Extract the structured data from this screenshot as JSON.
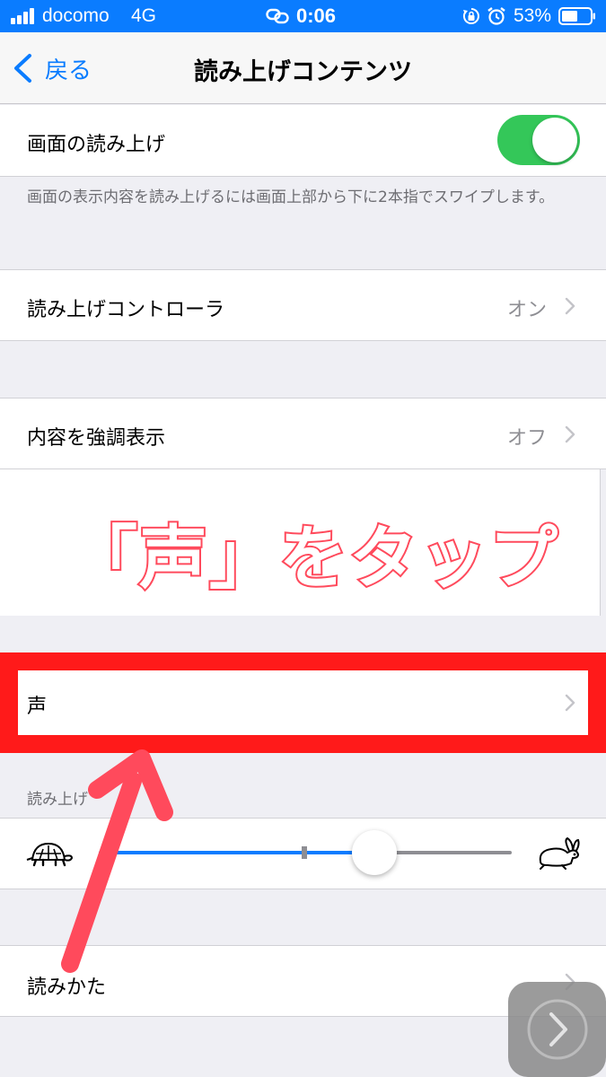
{
  "status_bar": {
    "carrier": "docomo",
    "network": "4G",
    "time": "0:06",
    "battery_percent": "53%"
  },
  "nav": {
    "back_label": "戻る",
    "title": "読み上げコンテンツ"
  },
  "speak_screen": {
    "label": "画面の読み上げ",
    "enabled": true,
    "footer": "画面の表示内容を読み上げるには画面上部から下に2本指でスワイプします。"
  },
  "speech_controller": {
    "label": "読み上げコントローラ",
    "value": "オン"
  },
  "highlight_content": {
    "label": "内容を強調表示",
    "value": "オフ"
  },
  "annotation": {
    "text": "「声」をタップ",
    "color": "#ff4a5c"
  },
  "voices": {
    "label": "声",
    "highlight_color": "#ff1a1a"
  },
  "speaking_rate": {
    "header": "読み上げ",
    "level": 0.66
  },
  "pronunciations": {
    "label": "読みかた"
  },
  "colors": {
    "accent": "#0a7cff",
    "toggle_on": "#34c759"
  },
  "icons": [
    "signal-icon",
    "link-icon",
    "orientation-lock-icon",
    "alarm-icon",
    "battery-icon",
    "back-chevron-icon",
    "chevron-right-icon",
    "turtle-icon",
    "rabbit-icon",
    "arrow-annotation",
    "assistive-touch-button"
  ]
}
